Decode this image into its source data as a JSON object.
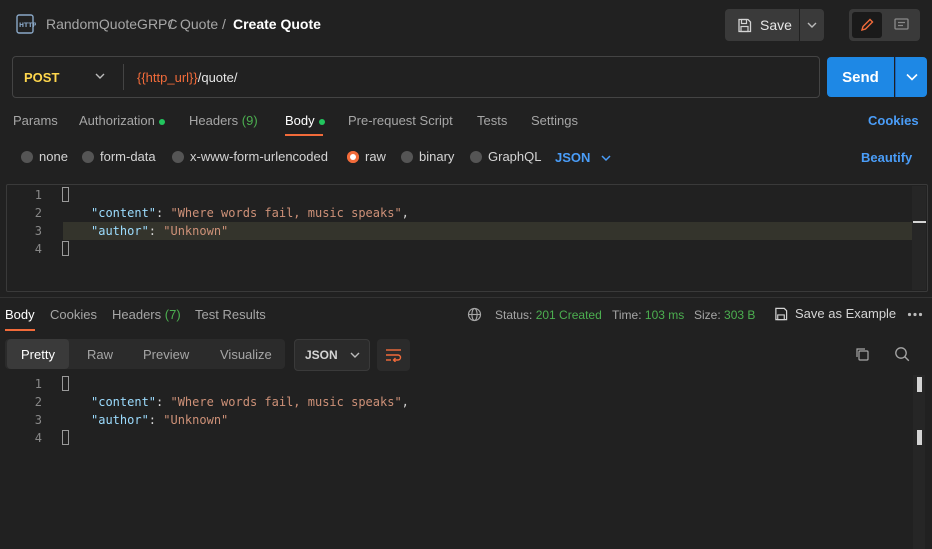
{
  "breadcrumb": {
    "collection": "RandomQuoteGRPC",
    "folder": "Quote",
    "request": "Create Quote",
    "sep": "/"
  },
  "header": {
    "save_label": "Save"
  },
  "request": {
    "method": "POST",
    "url_var": "{{http_url}}",
    "url_path": "/quote/",
    "send_label": "Send"
  },
  "request_tabs": {
    "params": "Params",
    "authorization": "Authorization",
    "headers": "Headers",
    "headers_count": "(9)",
    "body": "Body",
    "prerequest": "Pre-request Script",
    "tests": "Tests",
    "settings": "Settings",
    "cookies": "Cookies"
  },
  "body_types": {
    "none": "none",
    "form_data": "form-data",
    "urlencoded": "x-www-form-urlencoded",
    "raw": "raw",
    "binary": "binary",
    "graphql": "GraphQL",
    "format": "JSON",
    "beautify": "Beautify"
  },
  "request_body": {
    "lines": [
      "1",
      "2",
      "3",
      "4"
    ],
    "key_content": "\"content\"",
    "val_content": "\"Where words fail, music speaks\"",
    "key_author": "\"author\"",
    "val_author": "\"Unknown\"",
    "colon": ": ",
    "comma": ","
  },
  "response_tabs": {
    "body": "Body",
    "cookies": "Cookies",
    "headers": "Headers",
    "headers_count": "(7)",
    "test_results": "Test Results"
  },
  "response_status": {
    "status_label": "Status:",
    "status_value": "201 Created",
    "time_label": "Time:",
    "time_value": "103 ms",
    "size_label": "Size:",
    "size_value": "303 B",
    "save_example": "Save as Example"
  },
  "response_view": {
    "pretty": "Pretty",
    "raw": "Raw",
    "preview": "Preview",
    "visualize": "Visualize",
    "format": "JSON"
  },
  "response_body": {
    "lines": [
      "1",
      "2",
      "3",
      "4"
    ],
    "key_content": "\"content\"",
    "val_content": "\"Where words fail, music speaks\"",
    "key_author": "\"author\"",
    "val_author": "\"Unknown\""
  },
  "colors": {
    "accent": "#f26b3a",
    "primary": "#1e88e5",
    "link": "#4a9df8",
    "method": "#ffd74d",
    "success": "#4caf50"
  }
}
